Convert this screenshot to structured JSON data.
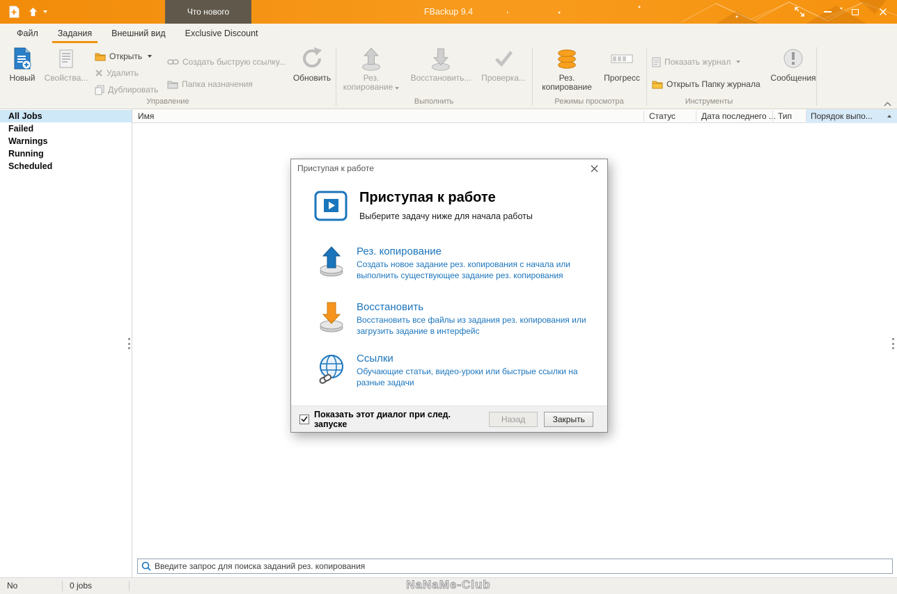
{
  "titlebar": {
    "title": "FBackup 9.4",
    "whats_new_label": "Что нового"
  },
  "tabs": {
    "file": "Файл",
    "jobs": "Задания",
    "view": "Внешний вид",
    "discount": "Exclusive Discount"
  },
  "ribbon": {
    "new_label": "Новый",
    "properties_label": "Свойства...",
    "open_label": "Открыть",
    "delete_label": "Удалить",
    "duplicate_label": "Дублировать",
    "quick_link_label": "Создать быструю ссылку...",
    "destination_label": "Папка назначения",
    "refresh_label": "Обновить",
    "backup_line1": "Рез.",
    "backup_line2": "копирование",
    "restore_label": "Восстановить...",
    "test_label": "Проверка...",
    "backup_view_line1": "Рез.",
    "backup_view_line2": "копирование",
    "progress_label": "Прогресс",
    "show_log_label": "Показать журнал",
    "open_log_folder_label": "Открыть Папку журнала",
    "messages_label": "Сообщения",
    "group_manage": "Управление",
    "group_execute": "Выполнить",
    "group_view_modes": "Режимы просмотра",
    "group_tools": "Инструменты"
  },
  "sidebar": {
    "items": [
      {
        "label": "All Jobs"
      },
      {
        "label": "Failed"
      },
      {
        "label": "Warnings"
      },
      {
        "label": "Running"
      },
      {
        "label": "Scheduled"
      }
    ]
  },
  "table": {
    "columns": {
      "name": "Имя",
      "status": "Статус",
      "last_date": "Дата последнего ...",
      "type": "Тип",
      "order": "Порядок выпо..."
    }
  },
  "dialog": {
    "title": "Приступая к работе",
    "heading": "Приступая к работе",
    "subheading": "Выберите задачу ниже для начала работы",
    "options": [
      {
        "title": "Рез. копирование",
        "description": "Создать новое задание рез. копирования с начала или выполнить существующее задание рез. копирования"
      },
      {
        "title": "Восстановить",
        "description": "Восстановить все файлы из задания рез. копирования или загрузить задание в интерфейс"
      },
      {
        "title": "Ссылки",
        "description": "Обучающие статьи, видео-уроки или быстрые ссылки на разные задачи"
      }
    ],
    "checkbox_label": "Показать этот диалог при след. запуске",
    "back_label": "Назад",
    "close_label": "Закрыть"
  },
  "search": {
    "placeholder": "Введите запрос для поиска заданий рез. копирования"
  },
  "statusbar": {
    "messages": "No messages",
    "jobs_count": "0 jobs"
  },
  "watermark": "NaNaMe-Club",
  "colors": {
    "accent_orange": "#F7941E",
    "link_blue": "#1B75BC",
    "selection_blue": "#CFE8F8"
  }
}
